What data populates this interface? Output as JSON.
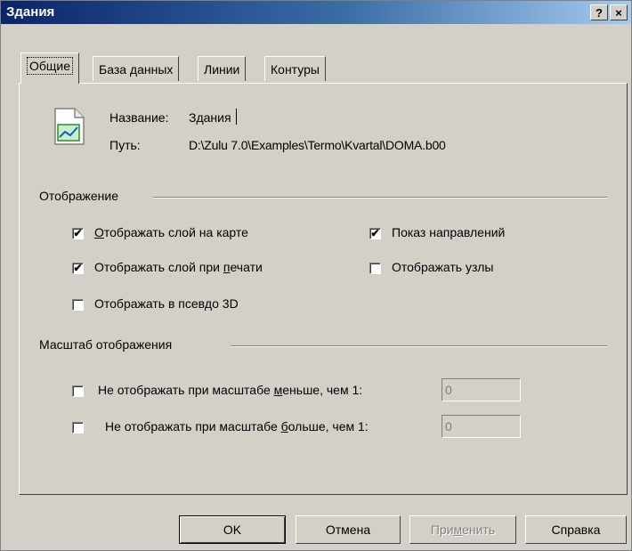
{
  "window": {
    "title": "Здания",
    "help_btn": "?",
    "close_btn": "×"
  },
  "tabs": [
    {
      "label": "Общие",
      "active": true
    },
    {
      "label": "База данных"
    },
    {
      "label": "Линии"
    },
    {
      "label": "Контуры"
    }
  ],
  "general": {
    "icon": "layer-document-icon",
    "name_label": "Название:",
    "name_value": "Здания",
    "path_label": "Путь:",
    "path_value": "D:\\Zulu 7.0\\Examples\\Termo\\Kvartal\\DOMA.b00"
  },
  "display_group": {
    "title": "Отображение",
    "show_on_map": {
      "pre": "",
      "ul": "О",
      "post": "тображать слой на карте",
      "checked": true
    },
    "show_directions": {
      "label": "Показ направлений",
      "checked": true
    },
    "show_on_print": {
      "pre": "Отображать слой при ",
      "ul": "п",
      "post": "ечати",
      "checked": true
    },
    "show_nodes": {
      "label": "Отображать узлы",
      "checked": false
    },
    "pseudo_3d": {
      "label": "Отображать в псевдо 3D",
      "checked": false
    }
  },
  "scale_group": {
    "title": "Масштаб отображения",
    "hide_smaller": {
      "pre": "Не отображать при масштабе ",
      "ul": "м",
      "post": "еньше, чем 1:",
      "checked": false,
      "value": "0"
    },
    "hide_larger": {
      "pre": "Не отображать при масштабе ",
      "ul": "б",
      "post": "ольше, чем 1:",
      "checked": false,
      "value": "0"
    }
  },
  "buttons": {
    "ok": "OK",
    "cancel": "Отмена",
    "apply": {
      "pre": "При",
      "ul": "м",
      "post": "енить"
    },
    "help": "Справка"
  },
  "check_mark": "✔"
}
